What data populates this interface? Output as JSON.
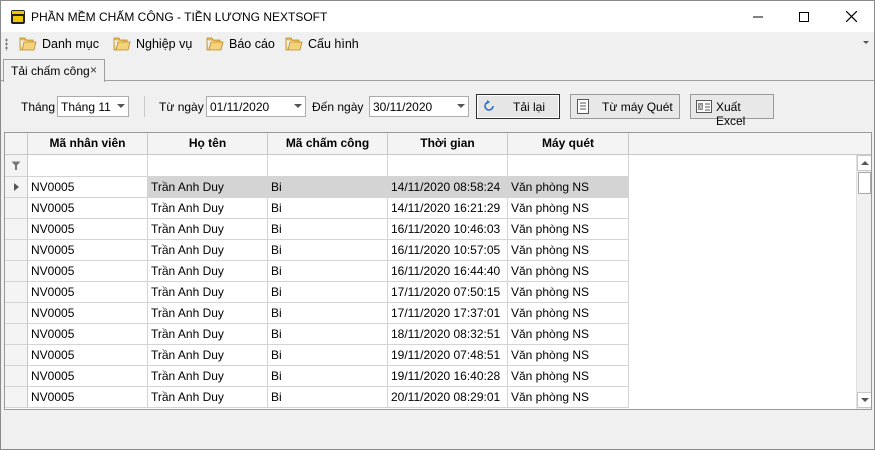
{
  "window": {
    "title": "PHẦN MỀM CHẤM CÔNG - TIỀN LƯƠNG NEXTSOFT",
    "icon": "app-logo-icon"
  },
  "menu": {
    "items": [
      {
        "label": "Danh mục",
        "icon": "folder-icon"
      },
      {
        "label": "Nghiệp vụ",
        "icon": "folder-icon"
      },
      {
        "label": "Báo cáo",
        "icon": "folder-icon"
      },
      {
        "label": "Cấu hình",
        "icon": "folder-icon"
      }
    ]
  },
  "tab": {
    "label": "Tải chấm công",
    "close": "×"
  },
  "filters": {
    "month_label": "Tháng",
    "month_value": "Tháng 11",
    "from_label": "Từ ngày",
    "from_value": "01/11/2020",
    "to_label": "Đến ngày",
    "to_value": "30/11/2020",
    "reload_label": "Tải lại",
    "from_machine_label": "Từ máy Quét",
    "export_label": "Xuất Excel"
  },
  "grid": {
    "columns": [
      "Mã nhân viên",
      "Họ tên",
      "Mã chấm công",
      "Thời gian",
      "Máy quét"
    ],
    "rows": [
      [
        "NV0005",
        "Trần Anh Duy",
        "Bi",
        "14/11/2020 08:58:24",
        "Văn phòng NS"
      ],
      [
        "NV0005",
        "Trần Anh Duy",
        "Bi",
        "14/11/2020 16:21:29",
        "Văn phòng NS"
      ],
      [
        "NV0005",
        "Trần Anh Duy",
        "Bi",
        "16/11/2020 10:46:03",
        "Văn phòng NS"
      ],
      [
        "NV0005",
        "Trần Anh Duy",
        "Bi",
        "16/11/2020 10:57:05",
        "Văn phòng NS"
      ],
      [
        "NV0005",
        "Trần Anh Duy",
        "Bi",
        "16/11/2020 16:44:40",
        "Văn phòng NS"
      ],
      [
        "NV0005",
        "Trần Anh Duy",
        "Bi",
        "17/11/2020 07:50:15",
        "Văn phòng NS"
      ],
      [
        "NV0005",
        "Trần Anh Duy",
        "Bi",
        "17/11/2020 17:37:01",
        "Văn phòng NS"
      ],
      [
        "NV0005",
        "Trần Anh Duy",
        "Bi",
        "18/11/2020 08:32:51",
        "Văn phòng NS"
      ],
      [
        "NV0005",
        "Trần Anh Duy",
        "Bi",
        "19/11/2020 07:48:51",
        "Văn phòng NS"
      ],
      [
        "NV0005",
        "Trần Anh Duy",
        "Bi",
        "19/11/2020 16:40:28",
        "Văn phòng NS"
      ],
      [
        "NV0005",
        "Trần Anh Duy",
        "Bi",
        "20/11/2020 08:29:01",
        "Văn phòng NS"
      ]
    ],
    "selected_row": 0
  }
}
